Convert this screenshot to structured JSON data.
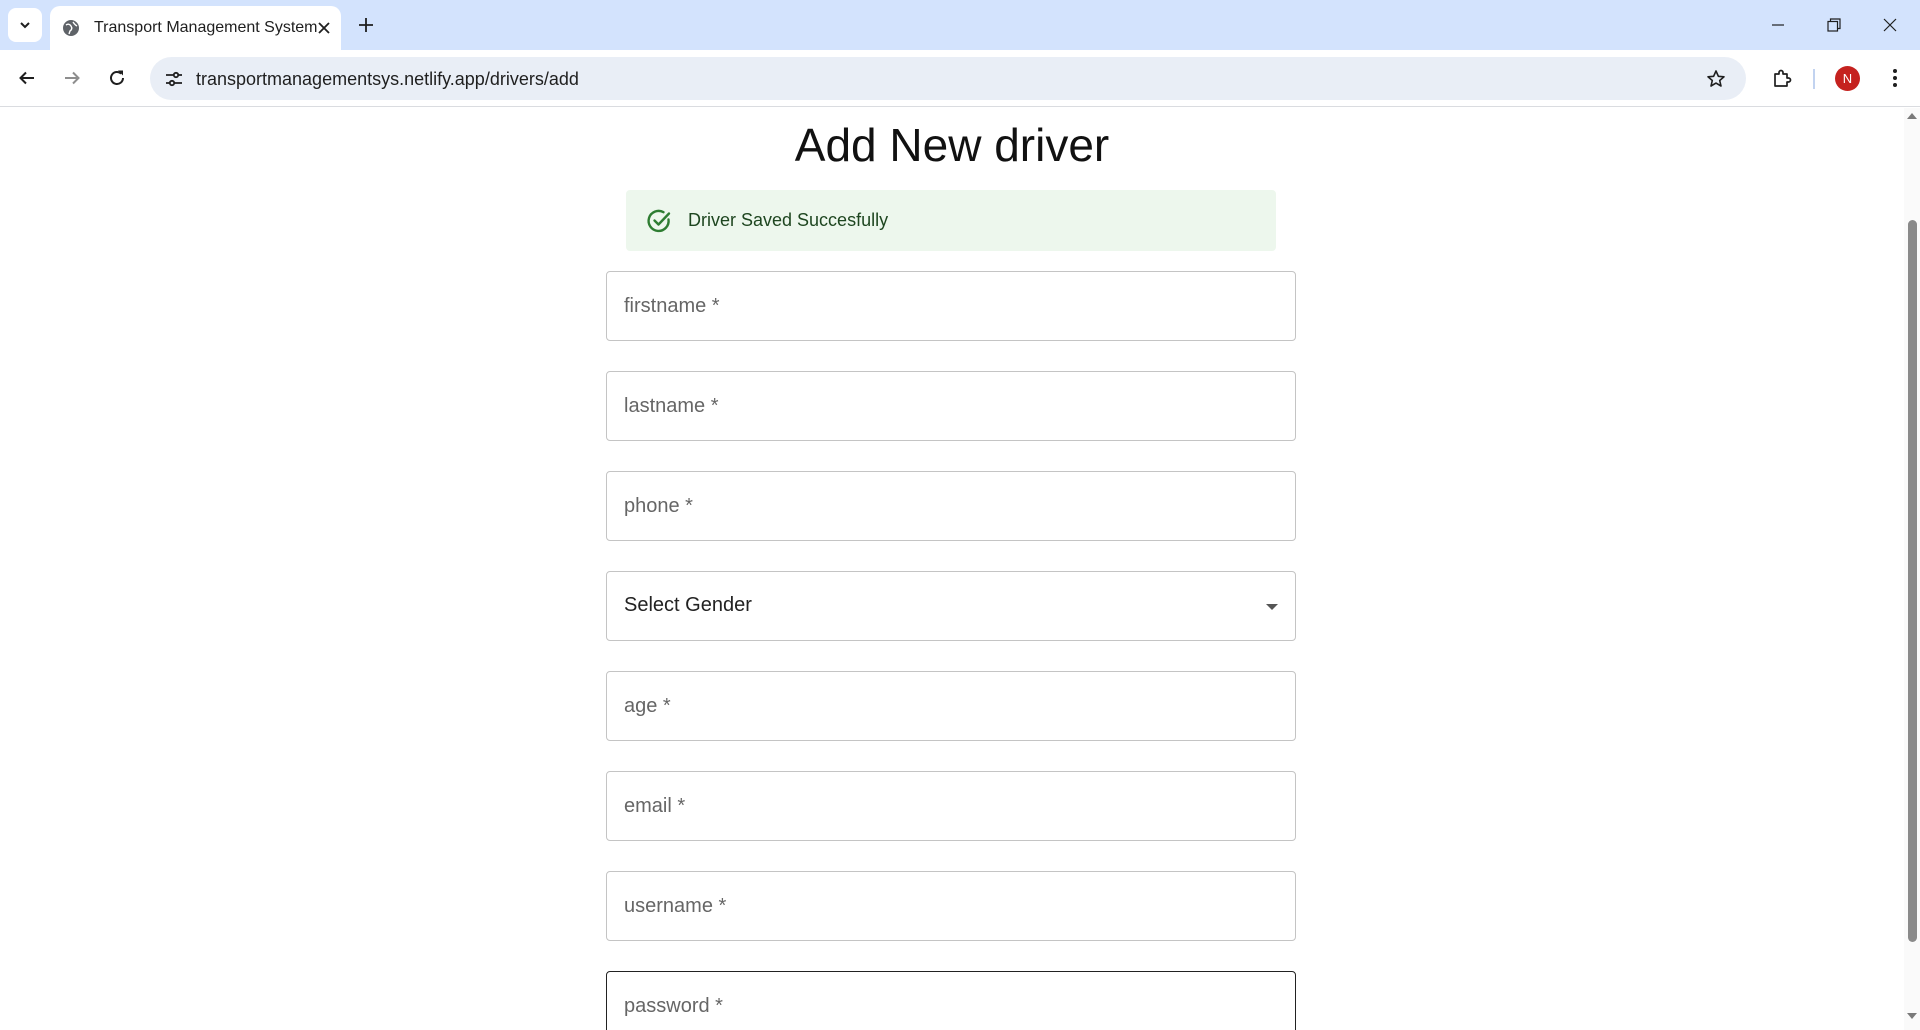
{
  "browser": {
    "tab_title": "Transport Management System",
    "url": "transportmanagementsys.netlify.app/drivers/add",
    "profile_initial": "N"
  },
  "page": {
    "title": "Add New driver",
    "alert": {
      "message": "Driver Saved Succesfully",
      "severity": "success"
    },
    "form": {
      "firstname_placeholder": "firstname *",
      "lastname_placeholder": "lastname *",
      "phone_placeholder": "phone *",
      "gender_select_value": "Select Gender",
      "age_placeholder": "age *",
      "email_placeholder": "email *",
      "username_placeholder": "username *",
      "password_placeholder": "password *"
    }
  },
  "colors": {
    "tabbar_bg": "#d3e3fd",
    "alert_bg": "#edf7ed",
    "alert_text": "#1e4620",
    "alert_icon": "#2e7d32",
    "avatar_bg": "#c5221f"
  }
}
